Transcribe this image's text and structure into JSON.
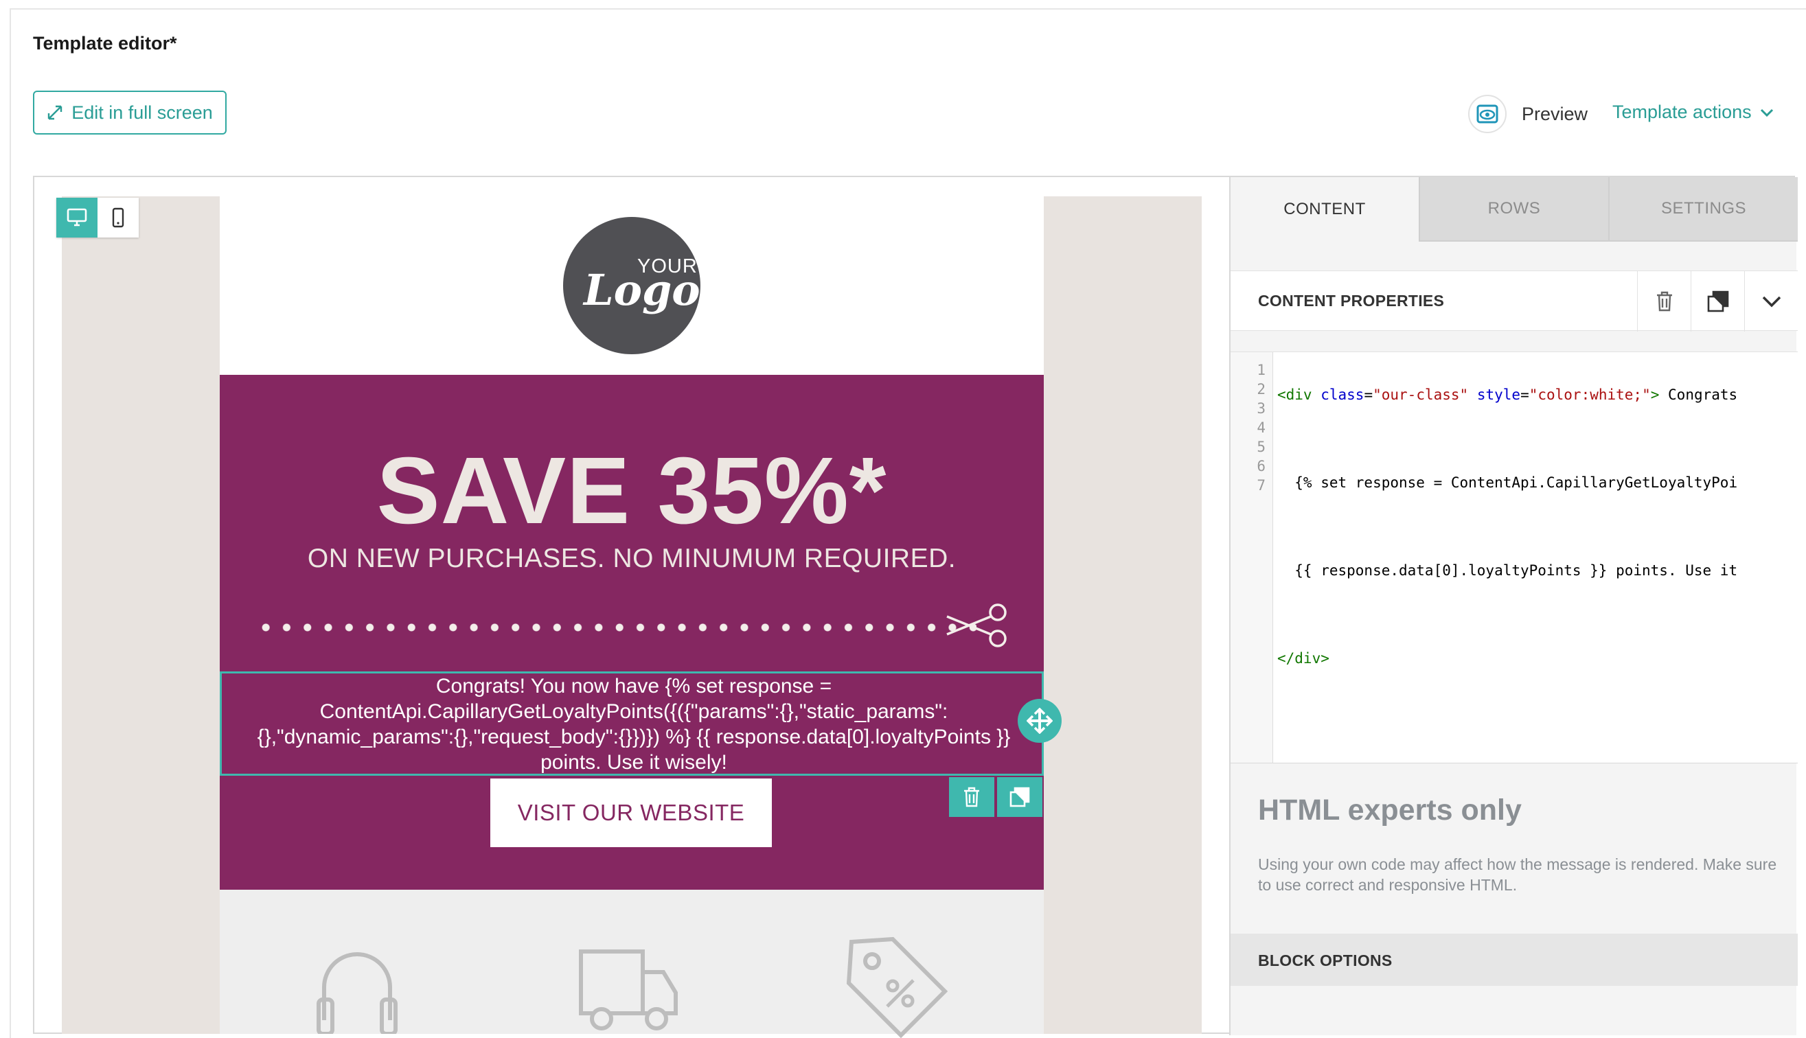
{
  "header": {
    "title": "Template editor*",
    "fullscreen_label": "Edit in full screen",
    "preview_label": "Preview",
    "template_actions_label": "Template actions"
  },
  "email": {
    "logo_your": "YOUR",
    "logo_text": "Logo",
    "headline": "SAVE 35%*",
    "subheadline": "ON NEW PURCHASES. NO MINUMUM REQUIRED.",
    "congrats_text": "Congrats! You now have {% set response = ContentApi.CapillaryGetLoyaltyPoints({({\"params\":{},\"static_params\":{},\"dynamic_params\":{},\"request_body\":{}})}) %} {{ response.data[0].loyaltyPoints }} points. Use it wisely!",
    "cta_label": "VISIT OUR WEBSITE",
    "colors": {
      "banner": "#852761",
      "accent": "#3fb8ae"
    }
  },
  "panel": {
    "tabs": [
      "CONTENT",
      "ROWS",
      "SETTINGS"
    ],
    "active_tab": "CONTENT",
    "content_properties_title": "CONTENT PROPERTIES",
    "code_line_numbers": [
      "1",
      "2",
      "3",
      "4",
      "5",
      "6",
      "7"
    ],
    "code": {
      "l1_tag_open": "<div",
      "l1_attr_class": "class",
      "l1_eq1": "=",
      "l1_val_class": "\"our-class\"",
      "l1_attr_style": "style",
      "l1_eq2": "=",
      "l1_val_style": "\"color:white;\"",
      "l1_close": ">",
      "l1_text": " Congrats",
      "l3": "  {% set response = ContentApi.CapillaryGetLoyaltyPoi",
      "l5": "  {{ response.data[0].loyaltyPoints }} points. Use it",
      "l7": "</div>"
    },
    "experts_title": "HTML experts only",
    "experts_desc": "Using your own code may affect how the message is rendered. Make sure to use correct and responsive HTML.",
    "block_options_title": "BLOCK OPTIONS"
  }
}
